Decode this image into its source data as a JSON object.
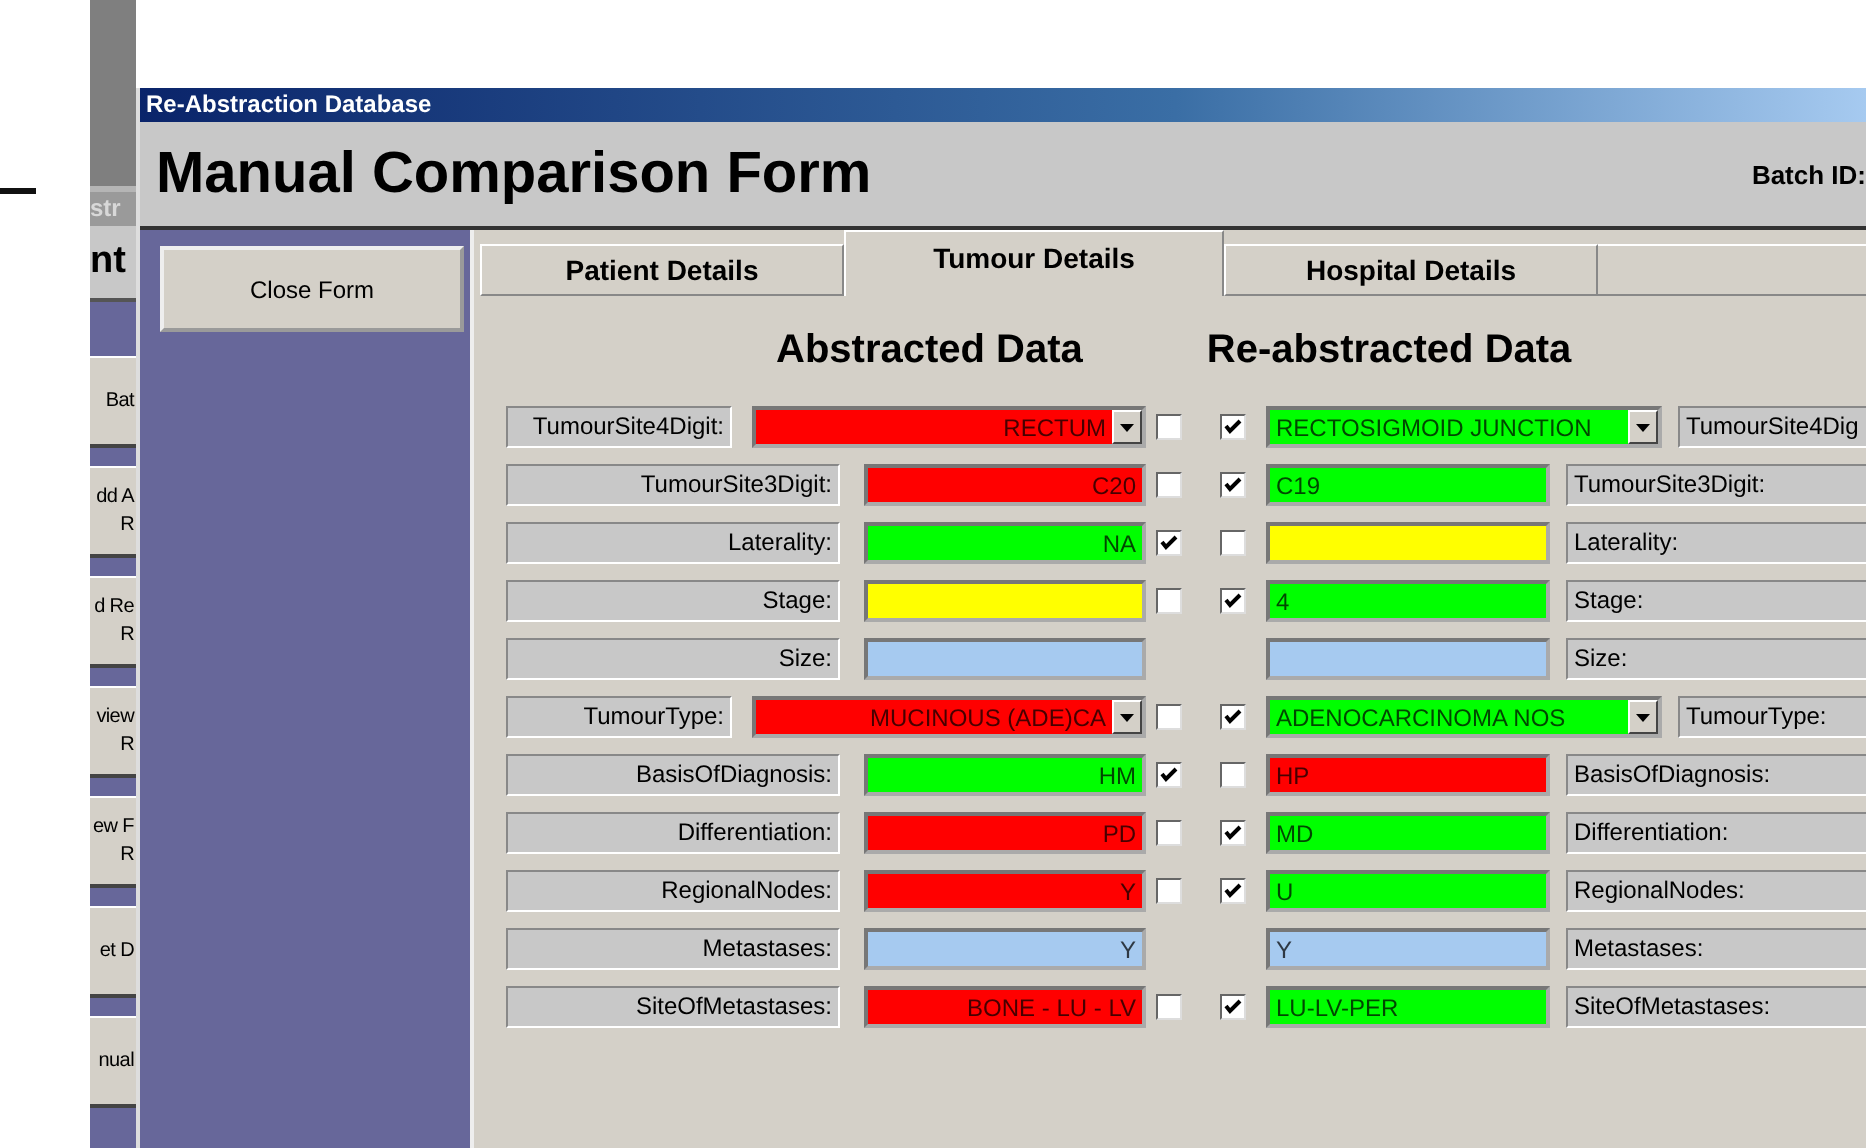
{
  "back_window": {
    "title_fragment": "str",
    "heading_fragment": "nt",
    "buttons": [
      {
        "lines": [
          "Bat"
        ]
      },
      {
        "lines": [
          "dd A",
          "R"
        ]
      },
      {
        "lines": [
          "d Re",
          "R"
        ]
      },
      {
        "lines": [
          "view",
          "R"
        ]
      },
      {
        "lines": [
          "ew F",
          "R"
        ]
      },
      {
        "lines": [
          "et D"
        ]
      },
      {
        "lines": [
          "nual"
        ]
      }
    ]
  },
  "window": {
    "title": "Re-Abstraction Database"
  },
  "header": {
    "title": "Manual Comparison Form",
    "batch_label": "Batch ID:"
  },
  "sidebar": {
    "button": "Close Form"
  },
  "tabs": [
    {
      "label": "Patient Details",
      "selected": false
    },
    {
      "label": "Tumour Details",
      "selected": true
    },
    {
      "label": "Hospital Details",
      "selected": false
    }
  ],
  "headings": {
    "abstracted": "Abstracted Data",
    "reabstracted": "Re-abstracted Data"
  },
  "rows": [
    {
      "kind": "combo",
      "label": "TumourSite4Digit:",
      "abstracted": {
        "value": "RECTUM",
        "color": "#ff0000",
        "checked": false
      },
      "reabstracted": {
        "checked": true,
        "value": "RECTOSIGMOID JUNCTION",
        "color": "#00ff00",
        "label": "TumourSite4Dig"
      }
    },
    {
      "kind": "text",
      "label": "TumourSite3Digit:",
      "abstracted": {
        "value": "C20",
        "color": "#ff0000",
        "checked": false
      },
      "reabstracted": {
        "checked": true,
        "value": "C19",
        "color": "#00ff00",
        "label": "TumourSite3Digit:"
      }
    },
    {
      "kind": "text",
      "label": "Laterality:",
      "abstracted": {
        "value": "NA",
        "color": "#00ff00",
        "checked": true
      },
      "reabstracted": {
        "checked": false,
        "color": "#ffff00",
        "label": "Laterality:"
      }
    },
    {
      "kind": "text",
      "label": "Stage:",
      "abstracted": {
        "color": "#ffff00",
        "checked": false
      },
      "reabstracted": {
        "checked": true,
        "value": "4",
        "color": "#00ff00",
        "label": "Stage:"
      }
    },
    {
      "kind": "text",
      "label": "Size:",
      "abstracted": {
        "color": "#a6caf0"
      },
      "reabstracted": {
        "color": "#a6caf0",
        "label": "Size:"
      }
    },
    {
      "kind": "combo",
      "label": "TumourType:",
      "abstracted": {
        "value": "MUCINOUS (ADE)CA",
        "color": "#ff0000",
        "checked": false
      },
      "reabstracted": {
        "checked": true,
        "value": "ADENOCARCINOMA NOS",
        "color": "#00ff00",
        "label": "TumourType:"
      }
    },
    {
      "kind": "text",
      "label": "BasisOfDiagnosis:",
      "abstracted": {
        "value": "HM",
        "color": "#00ff00",
        "checked": true
      },
      "reabstracted": {
        "checked": false,
        "value": "HP",
        "color": "#ff0000",
        "label": "BasisOfDiagnosis:"
      }
    },
    {
      "kind": "text",
      "label": "Differentiation:",
      "abstracted": {
        "value": "PD",
        "color": "#ff0000",
        "checked": false
      },
      "reabstracted": {
        "checked": true,
        "value": "MD",
        "color": "#00ff00",
        "label": "Differentiation:"
      }
    },
    {
      "kind": "text",
      "label": "RegionalNodes:",
      "abstracted": {
        "value": "Y",
        "color": "#ff0000",
        "checked": false
      },
      "reabstracted": {
        "checked": true,
        "value": "U",
        "color": "#00ff00",
        "label": "RegionalNodes:"
      }
    },
    {
      "kind": "text",
      "label": "Metastases:",
      "abstracted": {
        "value": "Y",
        "color": "#a6caf0"
      },
      "reabstracted": {
        "value": "Y",
        "color": "#a6caf0",
        "label": "Metastases:"
      }
    },
    {
      "kind": "text",
      "label": "SiteOfMetastases:",
      "abstracted": {
        "value": "BONE - LU - LV",
        "color": "#ff0000",
        "checked": false
      },
      "reabstracted": {
        "checked": true,
        "value": "LU-LV-PER",
        "color": "#00ff00",
        "label": "SiteOfMetastases:"
      }
    }
  ]
}
